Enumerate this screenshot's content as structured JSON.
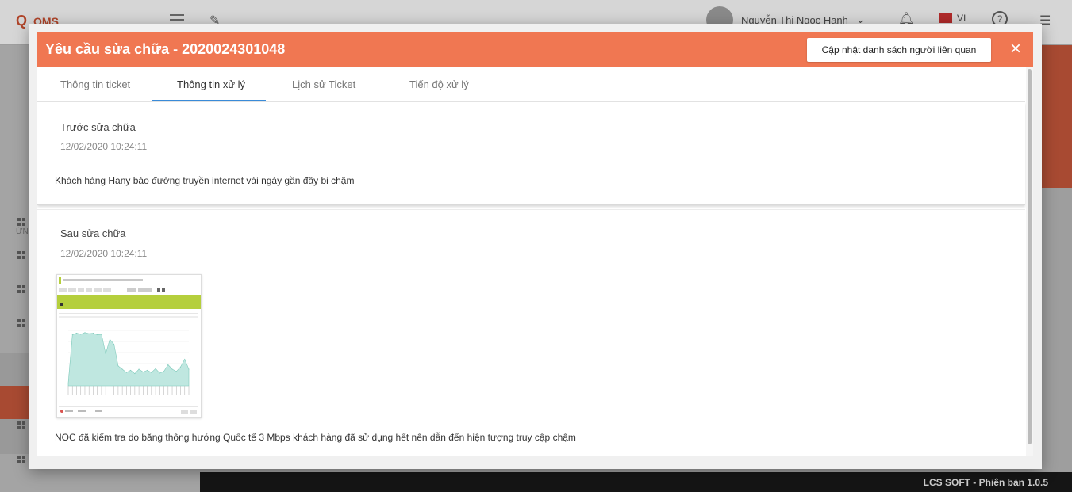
{
  "app": {
    "logo_text": "OMS",
    "user_name": "Nguyễn Thị Ngọc Hạnh",
    "language": "VI",
    "sidebar_section_label": "ỨN",
    "footer": "LCS SOFT - Phiên bản 1.0.5"
  },
  "modal": {
    "title": "Yêu cầu sửa chữa - 2020024301048",
    "update_button": "Cập nhật danh sách người liên quan",
    "close_icon": "×",
    "tabs": [
      {
        "label": "Thông tin ticket",
        "active": false
      },
      {
        "label": "Thông tin xử lý",
        "active": true
      },
      {
        "label": "Lịch sử Ticket",
        "active": false
      },
      {
        "label": "Tiến độ xử lý",
        "active": false
      }
    ],
    "before": {
      "title": "Trước sửa chữa",
      "time": "12/02/2020 10:24:11",
      "description": "Khách hàng Hany báo đường truyền internet vài ngày gần đây bị chậm"
    },
    "after": {
      "title": "Sau sửa chữa",
      "time": "12/02/2020 10:24:11",
      "description": "NOC đã kiểm tra do băng thông hướng Quốc tế 3 Mbps khách hàng đã sử dụng hết nên dẫn đến hiện tượng truy cập chậm"
    }
  },
  "colors": {
    "header": "#f07752",
    "tab_indicator": "#3a8bd8",
    "chart_fill": "#bfe7e0",
    "chart_band": "#b5cf3c"
  },
  "chart_data": {
    "type": "area",
    "title": "",
    "xlabel": "",
    "ylabel": "",
    "values": [
      5,
      92,
      95,
      93,
      96,
      94,
      95,
      92,
      93,
      58,
      84,
      75,
      36,
      30,
      24,
      28,
      22,
      30,
      25,
      28,
      24,
      31,
      23,
      26,
      38,
      30,
      26,
      34,
      48,
      30
    ],
    "ylim": [
      0,
      100
    ],
    "grid": true
  }
}
